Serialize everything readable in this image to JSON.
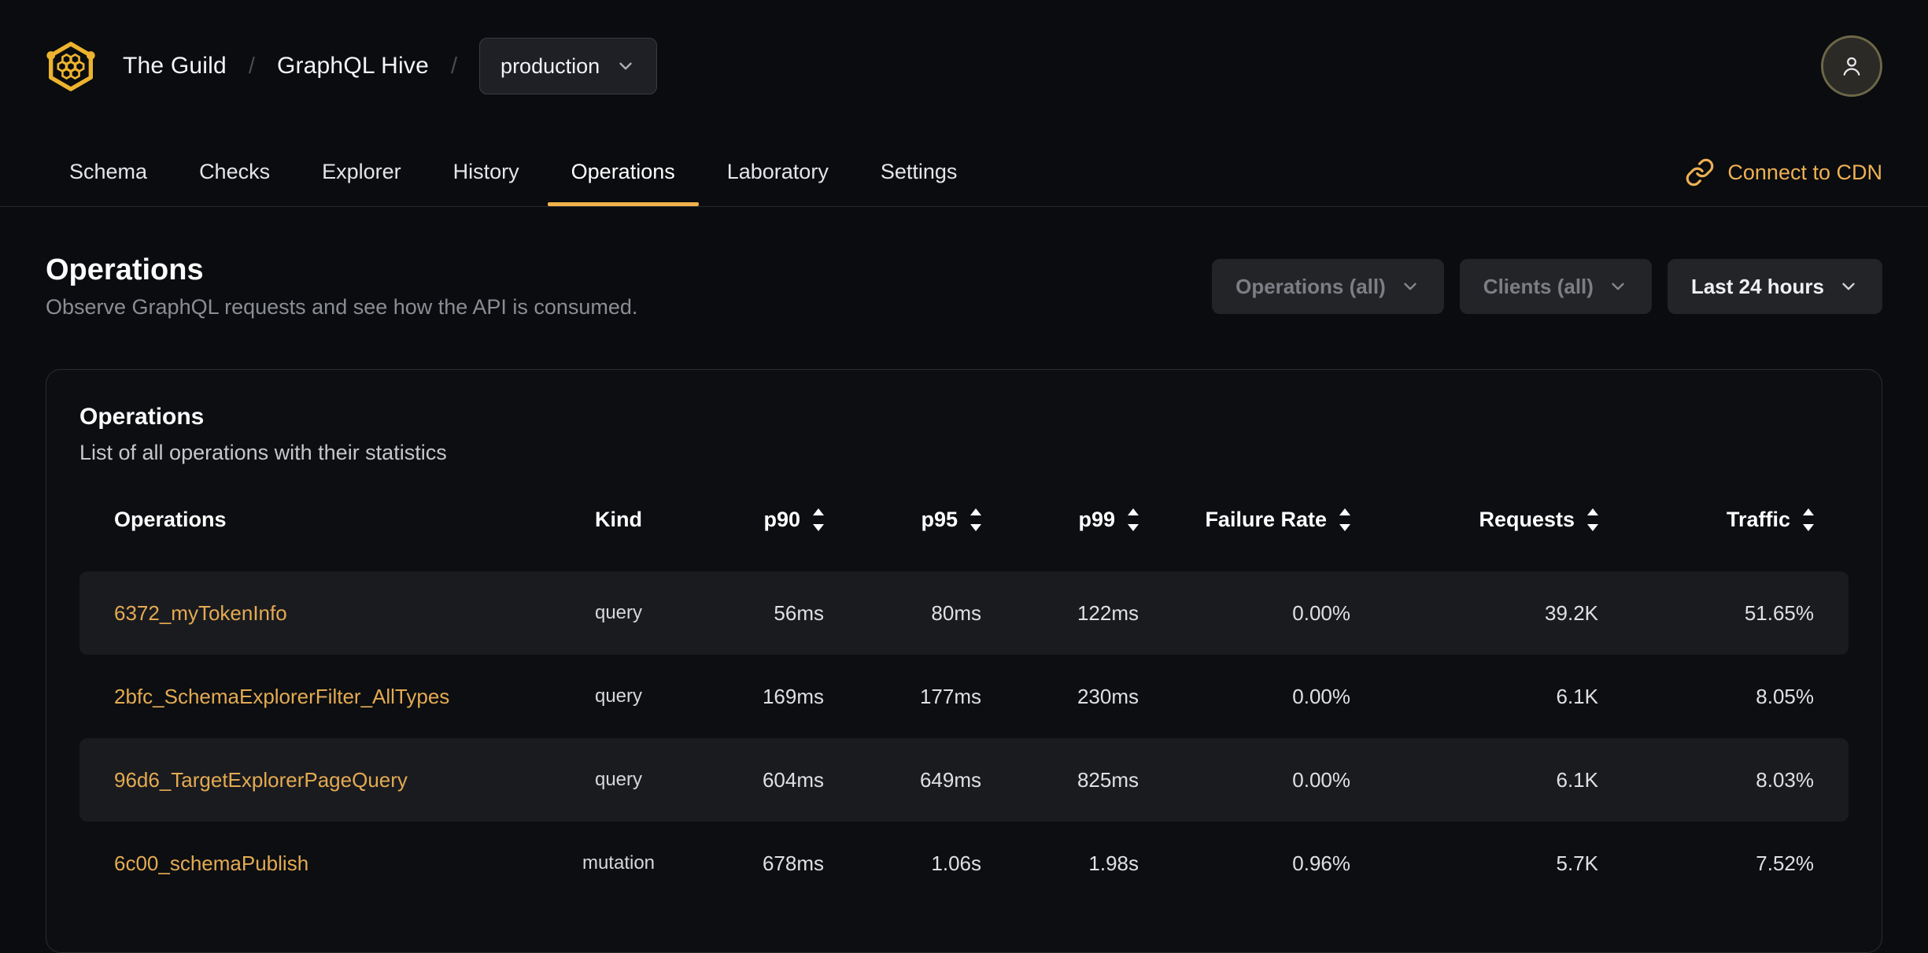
{
  "colors": {
    "background": "#0a0c0f",
    "accent_gold": "#f0b24a",
    "logo_gold": "#edb32f",
    "link_gold": "#e4aa52",
    "row_shaded": "#1a1b1f",
    "divider": "#26282c"
  },
  "icons": {
    "logo": "guild-honeycomb-logo",
    "avatar": "user-icon",
    "cdn": "link-icon",
    "dropdown": "chevron-down-icon",
    "sort": "sort-arrows-icon"
  },
  "topbar": {
    "org": "The Guild",
    "separator": "/",
    "project": "GraphQL Hive",
    "target": "production"
  },
  "nav": {
    "tabs": [
      {
        "label": "Schema",
        "active": false
      },
      {
        "label": "Checks",
        "active": false
      },
      {
        "label": "Explorer",
        "active": false
      },
      {
        "label": "History",
        "active": false
      },
      {
        "label": "Operations",
        "active": true
      },
      {
        "label": "Laboratory",
        "active": false
      },
      {
        "label": "Settings",
        "active": false
      }
    ],
    "cdn_link": "Connect to CDN"
  },
  "page_header": {
    "title": "Operations",
    "subtitle": "Observe GraphQL requests and see how the API is consumed."
  },
  "filters": [
    {
      "label": "Operations (all)",
      "muted": true
    },
    {
      "label": "Clients (all)",
      "muted": true
    },
    {
      "label": "Last 24 hours",
      "muted": false
    }
  ],
  "card": {
    "title": "Operations",
    "subtitle": "List of all operations with their statistics"
  },
  "table": {
    "columns": [
      {
        "key": "name",
        "label": "Operations",
        "sortable": false,
        "align": "left"
      },
      {
        "key": "kind",
        "label": "Kind",
        "sortable": false,
        "align": "center"
      },
      {
        "key": "p90",
        "label": "p90",
        "sortable": true,
        "align": "right"
      },
      {
        "key": "p95",
        "label": "p95",
        "sortable": true,
        "align": "right"
      },
      {
        "key": "p99",
        "label": "p99",
        "sortable": true,
        "align": "right"
      },
      {
        "key": "failure_rate",
        "label": "Failure Rate",
        "sortable": true,
        "align": "right"
      },
      {
        "key": "requests",
        "label": "Requests",
        "sortable": true,
        "align": "right"
      },
      {
        "key": "traffic",
        "label": "Traffic",
        "sortable": true,
        "align": "right"
      }
    ],
    "rows": [
      {
        "name": "6372_myTokenInfo",
        "kind": "query",
        "p90": "56ms",
        "p95": "80ms",
        "p99": "122ms",
        "failure_rate": "0.00%",
        "requests": "39.2K",
        "traffic": "51.65%"
      },
      {
        "name": "2bfc_SchemaExplorerFilter_AllTypes",
        "kind": "query",
        "p90": "169ms",
        "p95": "177ms",
        "p99": "230ms",
        "failure_rate": "0.00%",
        "requests": "6.1K",
        "traffic": "8.05%"
      },
      {
        "name": "96d6_TargetExplorerPageQuery",
        "kind": "query",
        "p90": "604ms",
        "p95": "649ms",
        "p99": "825ms",
        "failure_rate": "0.00%",
        "requests": "6.1K",
        "traffic": "8.03%"
      },
      {
        "name": "6c00_schemaPublish",
        "kind": "mutation",
        "p90": "678ms",
        "p95": "1.06s",
        "p99": "1.98s",
        "failure_rate": "0.96%",
        "requests": "5.7K",
        "traffic": "7.52%"
      }
    ]
  }
}
